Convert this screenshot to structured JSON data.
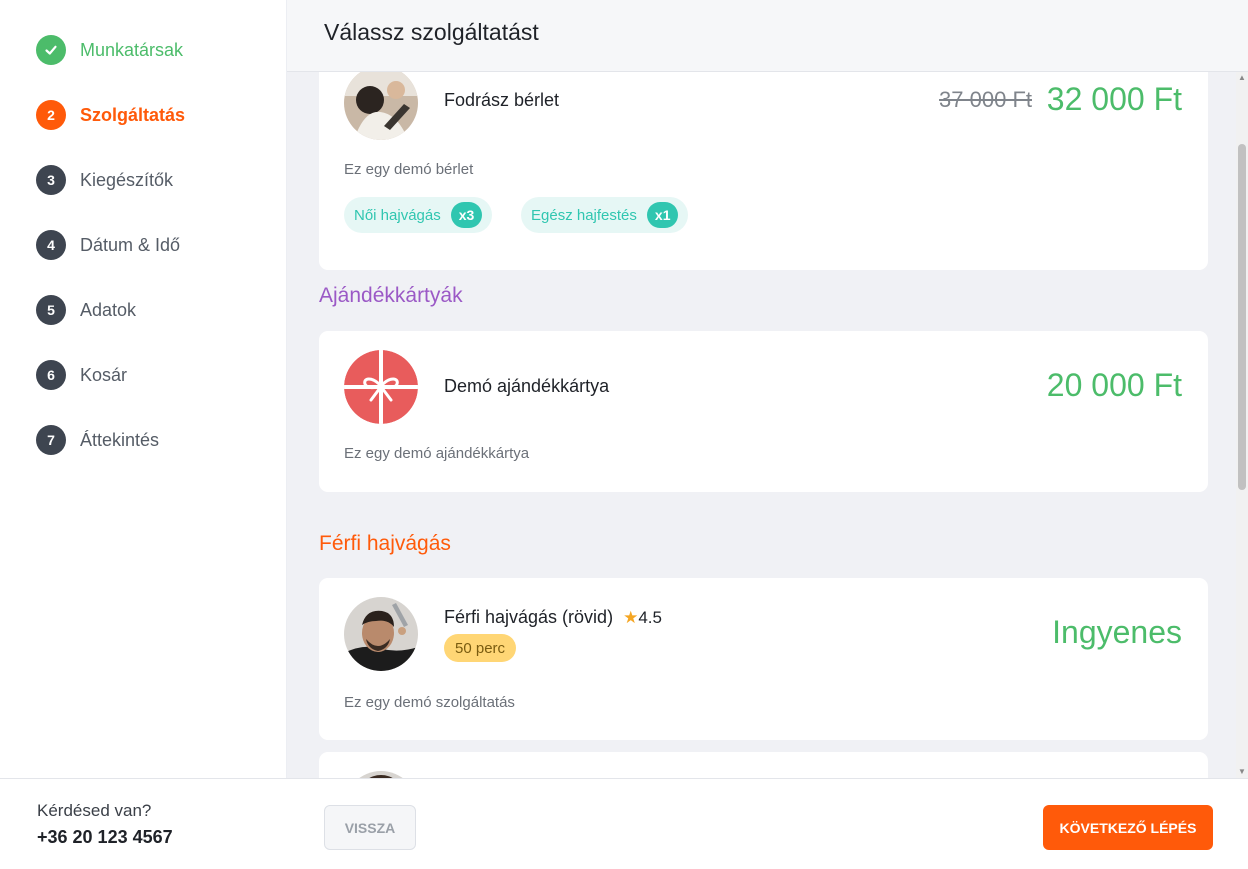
{
  "sidebar": {
    "steps": [
      {
        "number": "✓",
        "label": "Munkatársak",
        "state": "done"
      },
      {
        "number": "2",
        "label": "Szolgáltatás",
        "state": "active"
      },
      {
        "number": "3",
        "label": "Kiegészítők",
        "state": "pending"
      },
      {
        "number": "4",
        "label": "Dátum & Idő",
        "state": "pending"
      },
      {
        "number": "5",
        "label": "Adatok",
        "state": "pending"
      },
      {
        "number": "6",
        "label": "Kosár",
        "state": "pending"
      },
      {
        "number": "7",
        "label": "Áttekintés",
        "state": "pending"
      }
    ]
  },
  "header": {
    "title": "Válassz szolgáltatást"
  },
  "pass_card": {
    "title": "Fodrász bérlet",
    "old_price": "37 000 Ft",
    "price": "32 000 Ft",
    "description": "Ez egy demó bérlet",
    "tags": [
      {
        "label": "Női hajvágás",
        "count": "x3"
      },
      {
        "label": "Egész hajfestés",
        "count": "x1"
      }
    ]
  },
  "giftcard_section": {
    "title": "Ajándékkártyák",
    "color": "#9b59c6",
    "card": {
      "title": "Demó ajándékkártya",
      "price": "20 000 Ft",
      "description": "Ez egy demó ajándékkártya",
      "icon": "gift-icon",
      "icon_color": "#e85c5c"
    }
  },
  "mens_section": {
    "title": "Férfi hajvágás",
    "color": "#ff5a0a",
    "card": {
      "title": "Férfi hajvágás (rövid)",
      "rating": "4.5",
      "duration": "50 perc",
      "price": "Ingyenes",
      "description": "Ez egy demó szolgáltatás"
    }
  },
  "footer": {
    "help_question": "Kérdésed van?",
    "phone": "+36 20 123 4567",
    "back_label": "VISSZA",
    "next_label": "KÖVETKEZŐ LÉPÉS"
  },
  "colors": {
    "accent": "#ff5a0a",
    "success": "#4cbc6a",
    "teal": "#30c6b0"
  }
}
